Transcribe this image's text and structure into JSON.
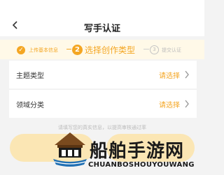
{
  "nav": {
    "title": "写手认证"
  },
  "steps": {
    "step1": {
      "label": "上传基本信息"
    },
    "step2": {
      "number": "2",
      "label": "选择创作类型"
    },
    "step3": {
      "number": "3",
      "label": "提交认证"
    }
  },
  "form": {
    "rows": [
      {
        "label": "主题类型",
        "value": "请选择"
      },
      {
        "label": "领域分类",
        "value": "请选择"
      }
    ],
    "hint": "请填写您的真实信息，以提高审核通过率"
  },
  "watermark": {
    "name": "船舶手游网",
    "sub": "CHUANBOSHOUYOUWANG"
  },
  "colors": {
    "accent": "#f4a623",
    "background": "#f3f3f3"
  }
}
